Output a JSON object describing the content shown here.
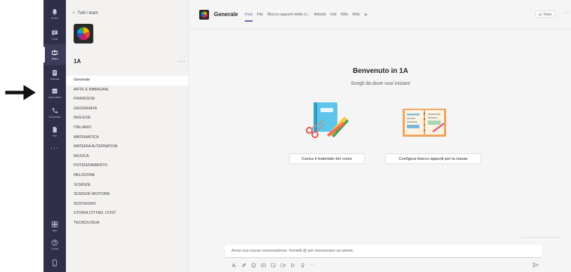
{
  "rail": {
    "items": [
      {
        "label": "Avvisi",
        "icon": "bell-icon"
      },
      {
        "label": "Chat",
        "icon": "chat-icon"
      },
      {
        "label": "Team",
        "icon": "team-icon",
        "active": true
      },
      {
        "label": "Attività",
        "icon": "assignments-icon"
      },
      {
        "label": "Calendario",
        "icon": "calendar-icon"
      },
      {
        "label": "Chiamate",
        "icon": "phone-icon"
      },
      {
        "label": "File",
        "icon": "file-icon"
      }
    ],
    "more": "···",
    "bottom": [
      {
        "label": "App",
        "icon": "apps-icon"
      },
      {
        "label": "Guida",
        "icon": "help-icon"
      }
    ]
  },
  "pane": {
    "back_label": "Tutti i team",
    "team_name": "1A",
    "more": "···",
    "channels": [
      "Generale",
      "ARTE E IMMAGINE",
      "FRANCESE",
      "GEOGRAFIA",
      "INGLESE",
      "ITALIANO",
      "MATEMATICA",
      "MATERIA ALTERNATIVA",
      "MUSICA",
      "POTENZIAMENTO",
      "RELIGIONE",
      "SCIENZE",
      "SCIENZE MOTORIE",
      "SOSTEGNO",
      "STORIA CITTAD. COST",
      "TECNOLOGIA"
    ]
  },
  "header": {
    "title": "Generale",
    "tabs": [
      "Post",
      "File",
      "Blocco appunti della cl...",
      "Attività",
      "Voti",
      "Wiki",
      "Wiki"
    ],
    "team_button": "Team",
    "more": "···"
  },
  "main": {
    "welcome": "Benvenuto in 1A",
    "subtitle": "Scegli da dove vuoi iniziare",
    "load_button": "Carica il materiale del corso",
    "config_button": "Configura blocco appunti per la classe"
  },
  "compose": {
    "placeholder": "Avvia una nuova conversazione. Immetti @ per menzionare un utente.",
    "more": "···"
  },
  "colors": {
    "rail_bg": "#2f2f4a",
    "accent": "#6264a7",
    "pane_bg": "#f3f2f1"
  }
}
